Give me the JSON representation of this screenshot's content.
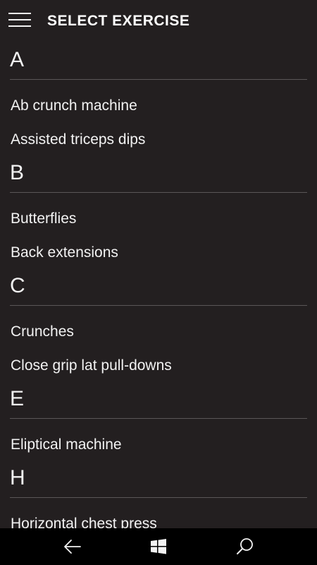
{
  "header": {
    "title": "SELECT EXERCISE"
  },
  "groups": [
    {
      "letter": "A",
      "items": [
        "Ab crunch machine",
        "Assisted triceps dips"
      ]
    },
    {
      "letter": "B",
      "items": [
        "Butterflies",
        "Back extensions"
      ]
    },
    {
      "letter": "C",
      "items": [
        "Crunches",
        "Close grip lat pull-downs"
      ]
    },
    {
      "letter": "E",
      "items": [
        "Eliptical machine"
      ]
    },
    {
      "letter": "H",
      "items": [
        "Horizontal chest press"
      ]
    }
  ],
  "navbar": {
    "back_icon": "back-arrow-icon",
    "home_icon": "windows-logo-icon",
    "search_icon": "search-icon"
  },
  "colors": {
    "background": "#231f20",
    "text": "#f2f2f2",
    "divider": "#5a5657",
    "navbar": "#000000"
  }
}
